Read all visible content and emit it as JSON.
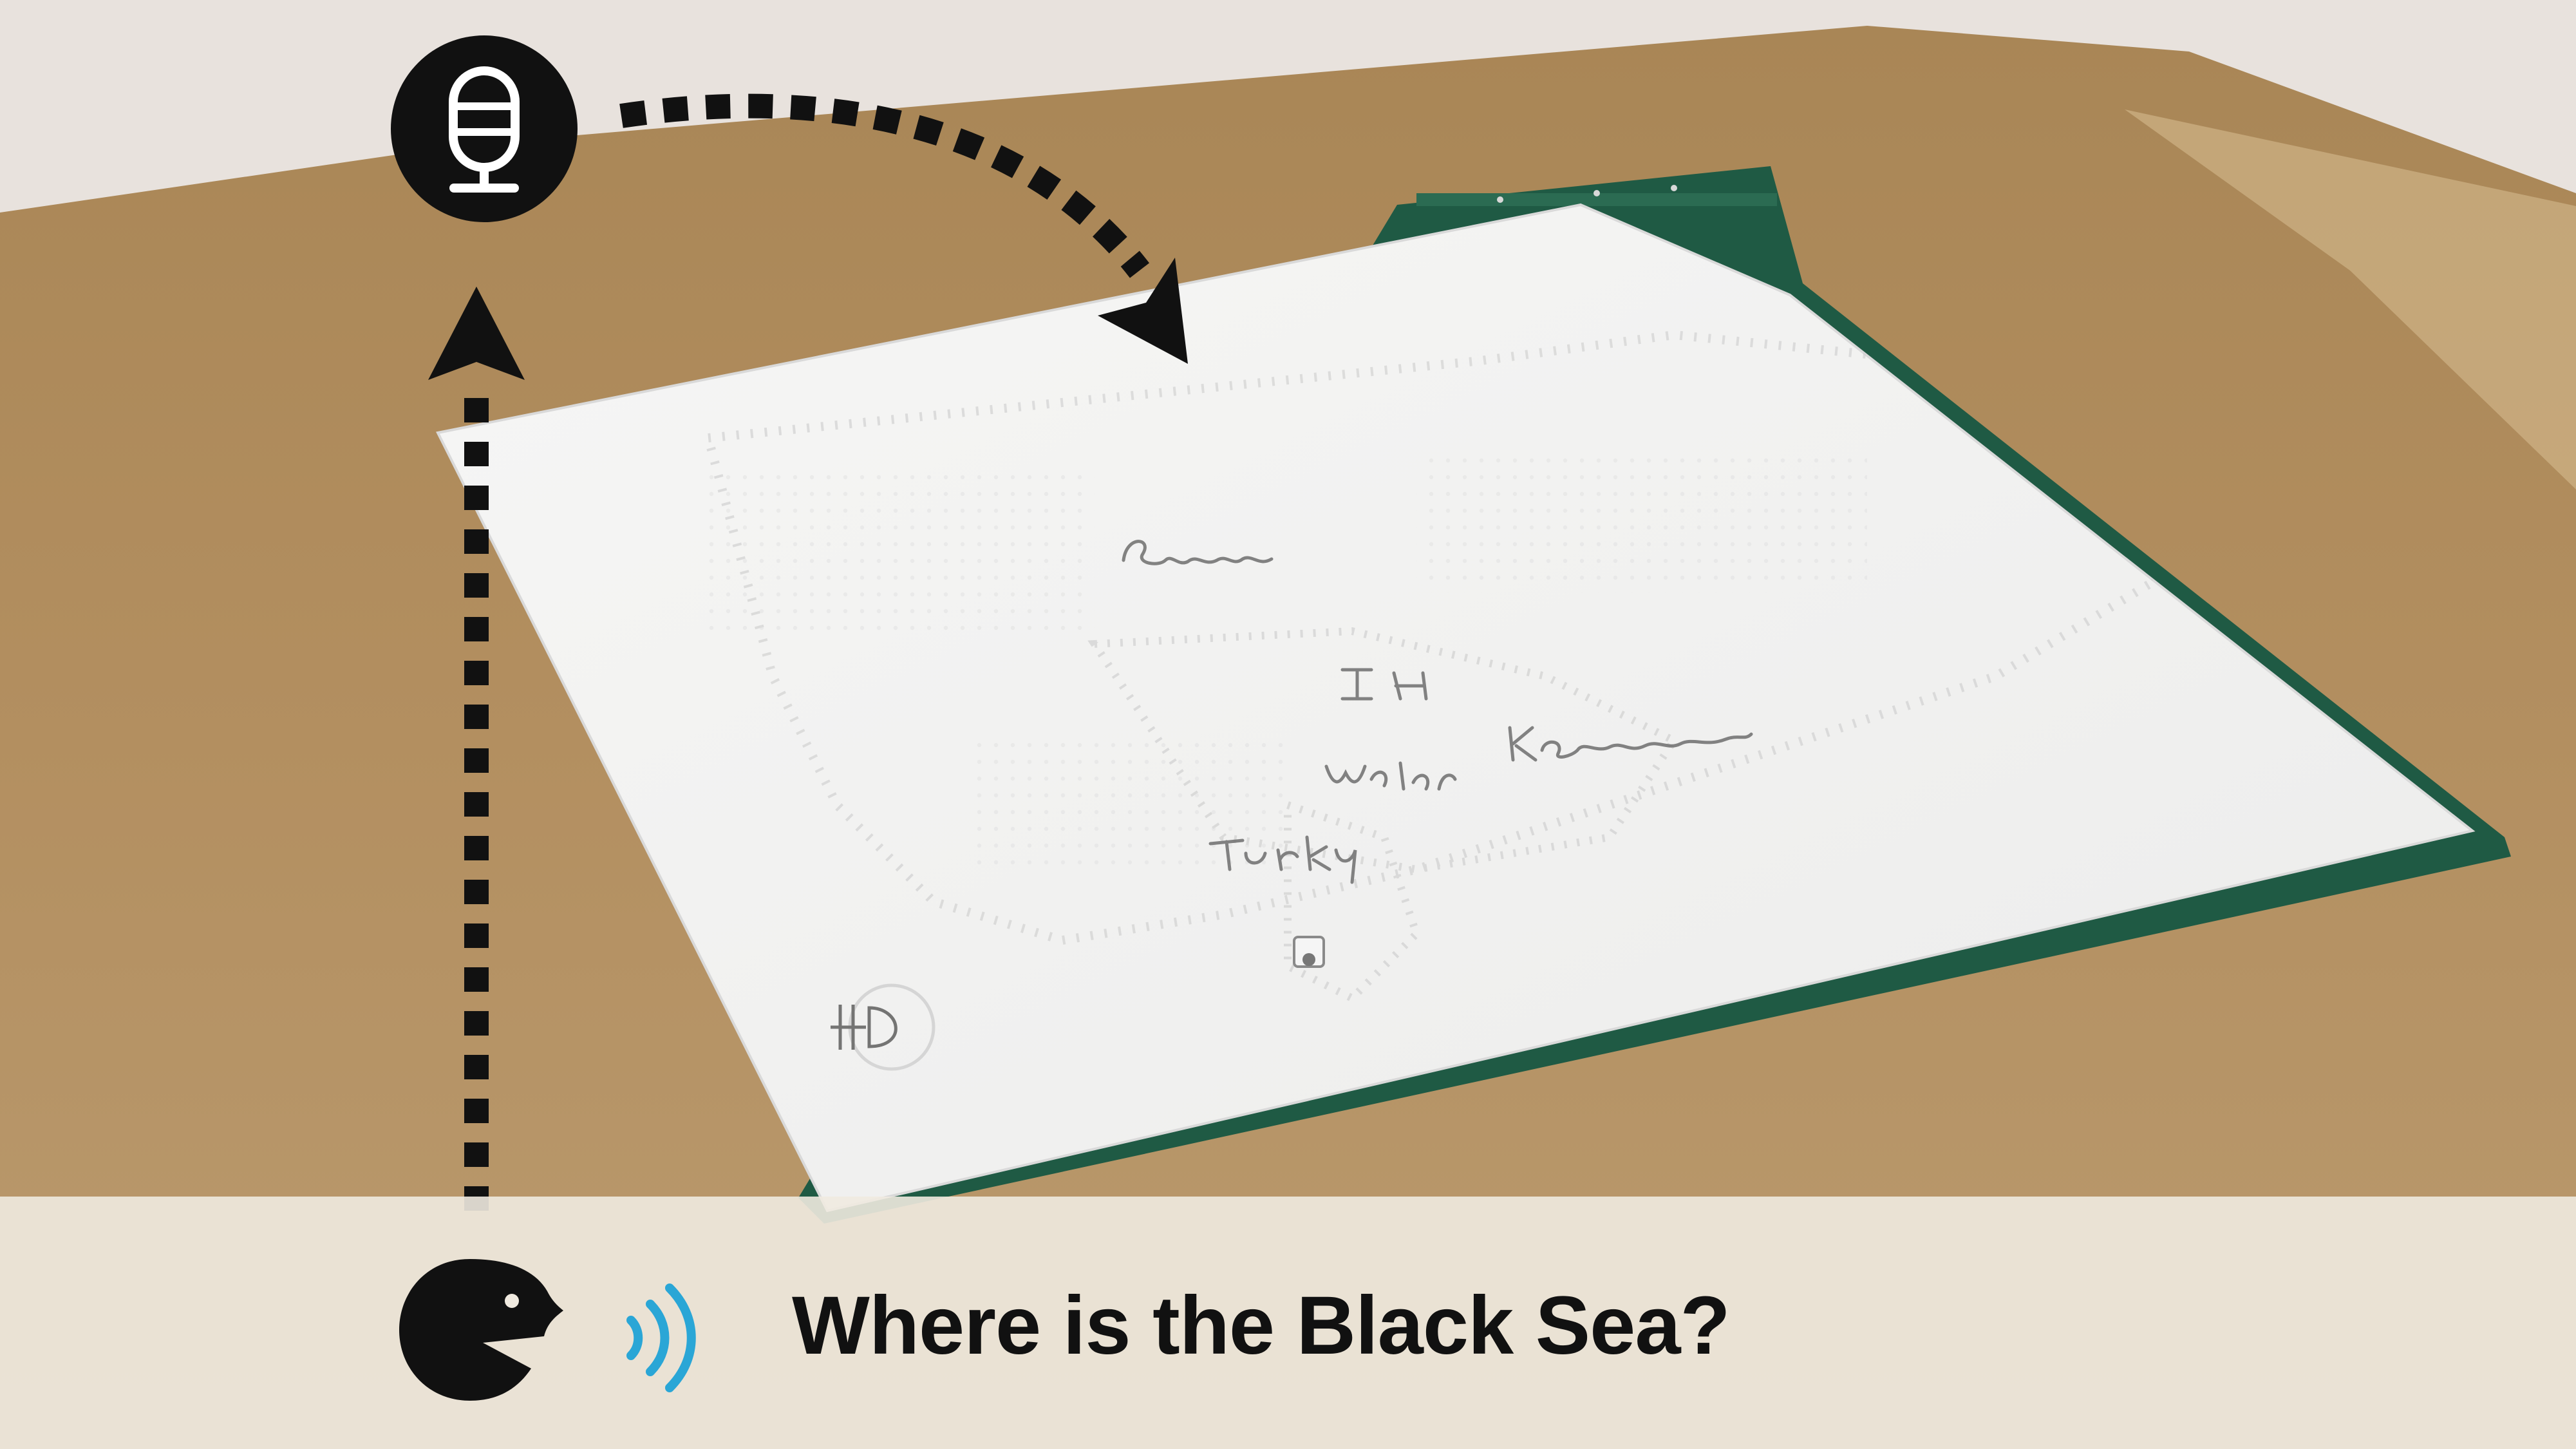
{
  "scene": {
    "photo_subject": "embossed-tactile-map-on-brown-table",
    "map_handwritten_labels": [
      "Rusia",
      "I H",
      "Kazakhstn",
      "water",
      "Turkey"
    ],
    "colors": {
      "table": "#b08d5e",
      "wall": "#e8e2dd",
      "paper": "#f3f3f3",
      "board": "#1f5a44",
      "caption_bar": "#f0eae0",
      "icon_black": "#111111",
      "sound_waves": "#2aa6d6"
    }
  },
  "icons": {
    "microphone": "microphone-icon",
    "speaker": "speaking-person-icon",
    "sound": "sound-waves-icon",
    "flow_up": "dashed-arrow-up-icon",
    "flow_curve": "dashed-curved-arrow-icon"
  },
  "caption": {
    "text": "Where is the Black Sea?"
  }
}
